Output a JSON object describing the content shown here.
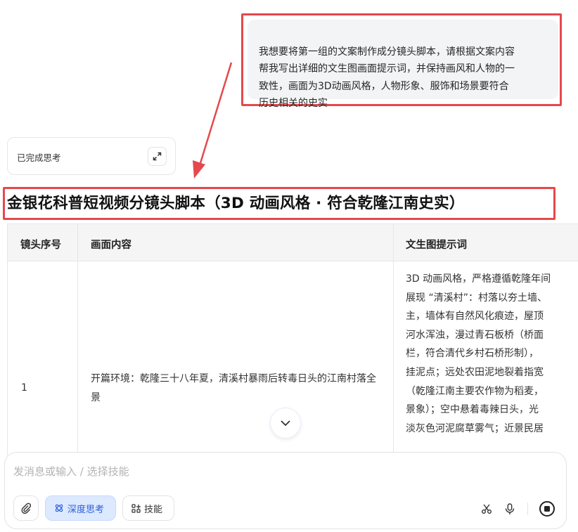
{
  "user_message": {
    "lines": [
      "我想要将第一组的文案制作成分镜头脚本，请根据文案内容",
      "帮我写出详细的文生图画面提示词，并保持画风和人物的一",
      "致性，画面为3D动画风格，人物形象、服饰和场景要符合",
      "历史相关的史实"
    ]
  },
  "thinking": {
    "label": "已完成思考",
    "icon": "expand-icon"
  },
  "response": {
    "title": "金银花科普短视频分镜头脚本（3D 动画风格 · 符合乾隆江南史实）",
    "table": {
      "headers": [
        "镜头序号",
        "画面内容",
        "文生图提示词"
      ],
      "rows": [
        {
          "shot": "1",
          "content": "开篇环境：乾隆三十八年夏，清溪村暴雨后转毒日头的江南村落全景",
          "prompt_lines": [
            "3D 动画风格，严格遵循乾隆年间",
            "展现 “清溪村”：村落以夯土墙、",
            "主，墙体有自然风化痕迹，屋顶",
            "河水浑浊，漫过青石板桥（桥面",
            "栏，符合清代乡村石桥形制），",
            "挂泥点；远处农田泥地裂着指宽",
            "（乾隆江南主要农作物为稻麦，",
            "景象）；空中悬着毒辣日头，光",
            "淡灰色河泥腐草雾气；近景民居"
          ]
        }
      ]
    }
  },
  "composer": {
    "placeholder": "发消息或输入 / 选择技能",
    "deep_think_label": "深度思考",
    "skills_label": "技能",
    "icons": [
      "paperclip-icon",
      "atom-icon",
      "grid-icon",
      "scissors-icon",
      "microphone-icon",
      "stop-icon"
    ]
  },
  "colors": {
    "highlight_border": "#e5484d",
    "accent": "#2b5fd9",
    "accent_bg": "#dde9ff",
    "bubble_bg": "#f3f4f6",
    "header_bg": "#f5f5f5"
  }
}
